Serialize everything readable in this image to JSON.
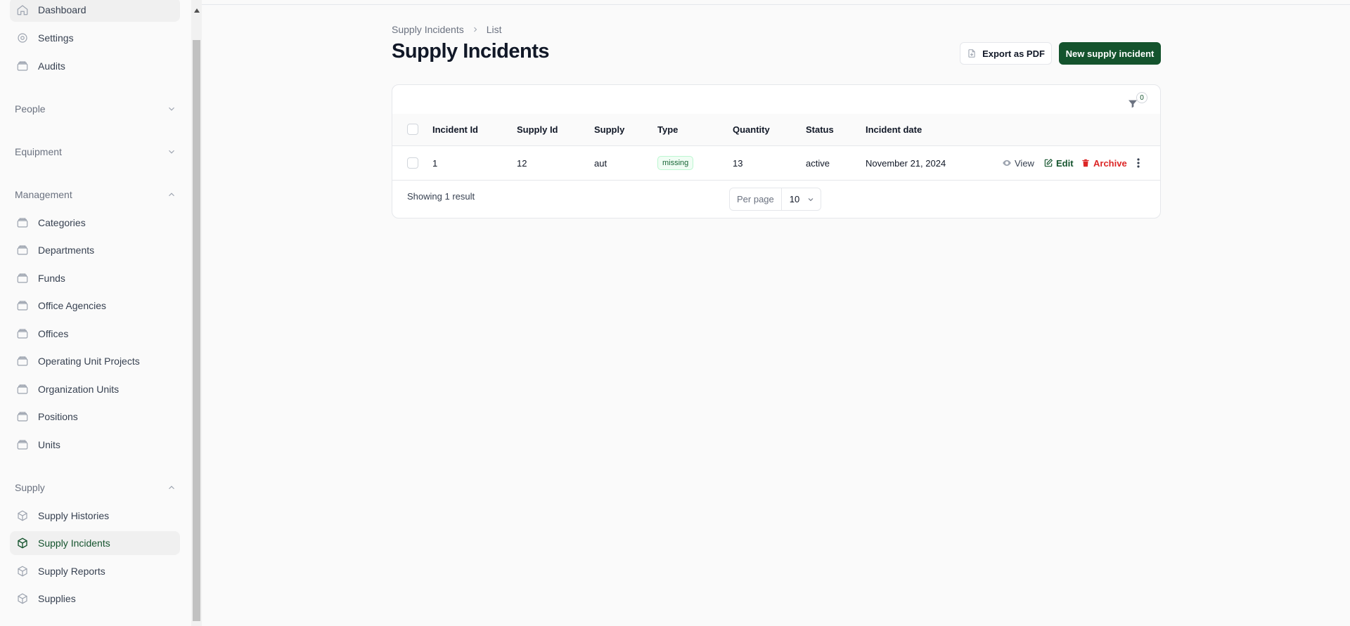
{
  "sidebar": {
    "top_items": [
      {
        "label": "Dashboard",
        "icon": "home-icon"
      },
      {
        "label": "Settings",
        "icon": "gear-icon"
      },
      {
        "label": "Audits",
        "icon": "folder-icon"
      }
    ],
    "groups": [
      {
        "label": "People",
        "expanded": false
      },
      {
        "label": "Equipment",
        "expanded": false
      },
      {
        "label": "Management",
        "expanded": true
      },
      {
        "label": "Supply",
        "expanded": true
      }
    ],
    "management_items": [
      "Categories",
      "Departments",
      "Funds",
      "Office Agencies",
      "Offices",
      "Operating Unit Projects",
      "Organization Units",
      "Positions",
      "Units"
    ],
    "supply_items": [
      "Supply Histories",
      "Supply Incidents",
      "Supply Reports",
      "Supplies"
    ],
    "active_item": "Supply Incidents"
  },
  "breadcrumb": {
    "parent": "Supply Incidents",
    "current": "List"
  },
  "page": {
    "title": "Supply Incidents"
  },
  "actions": {
    "export_label": "Export as PDF",
    "new_label": "New supply incident"
  },
  "filter": {
    "count": "0"
  },
  "table": {
    "columns": [
      "Incident Id",
      "Supply Id",
      "Supply",
      "Type",
      "Quantity",
      "Status",
      "Incident date"
    ],
    "rows": [
      {
        "incident_id": "1",
        "supply_id": "12",
        "supply": "aut",
        "type": "missing",
        "quantity": "13",
        "status": "active",
        "incident_date": "November 21, 2024"
      }
    ],
    "row_actions": {
      "view": "View",
      "edit": "Edit",
      "archive": "Archive"
    }
  },
  "pagination": {
    "summary": "Showing 1 result",
    "per_page_label": "Per page",
    "per_page_value": "10"
  },
  "colors": {
    "accent": "#14532d",
    "danger": "#dc2626",
    "sidebar_bg": "#fafafa"
  }
}
